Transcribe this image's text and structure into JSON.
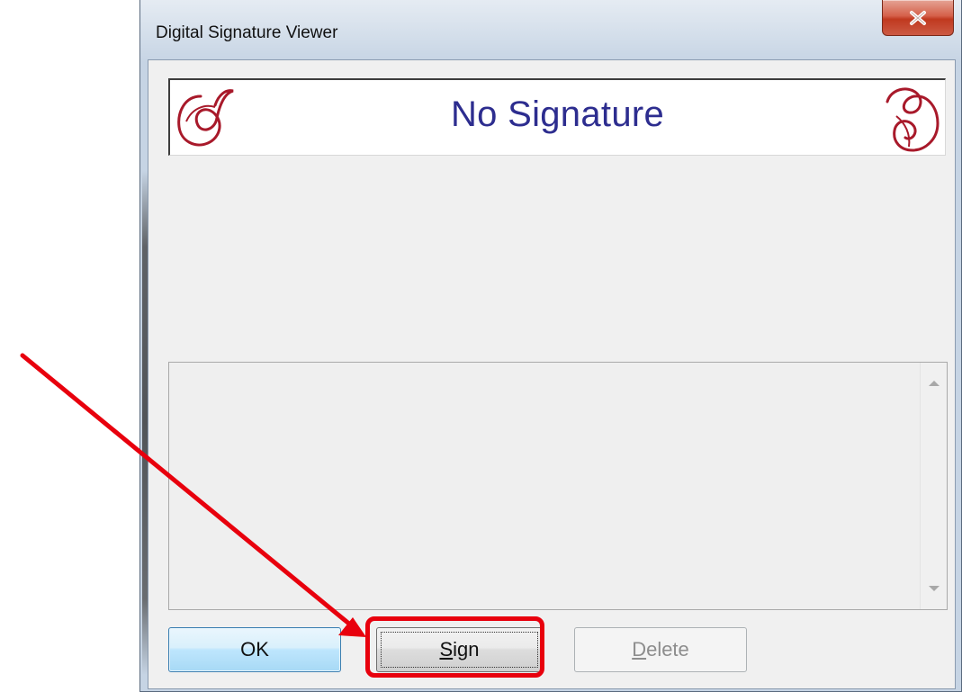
{
  "window": {
    "title": "Digital Signature Viewer",
    "close_glyph": "x"
  },
  "signature": {
    "status_text": "No Signature",
    "status_color": "#2d2d8f",
    "flourish_color": "#a8192a"
  },
  "buttons": {
    "ok_label": "OK",
    "sign_label": "Sign",
    "delete_label": "Delete",
    "delete_enabled": false
  },
  "annotation": {
    "color": "#e8000d",
    "target": "sign-button"
  },
  "icons": {
    "close": "close-icon",
    "left_flourish": "flourish-icon",
    "right_flourish": "flourish-icon",
    "scroll_up": "scroll-up-arrow-icon",
    "scroll_down": "scroll-down-arrow-icon"
  }
}
